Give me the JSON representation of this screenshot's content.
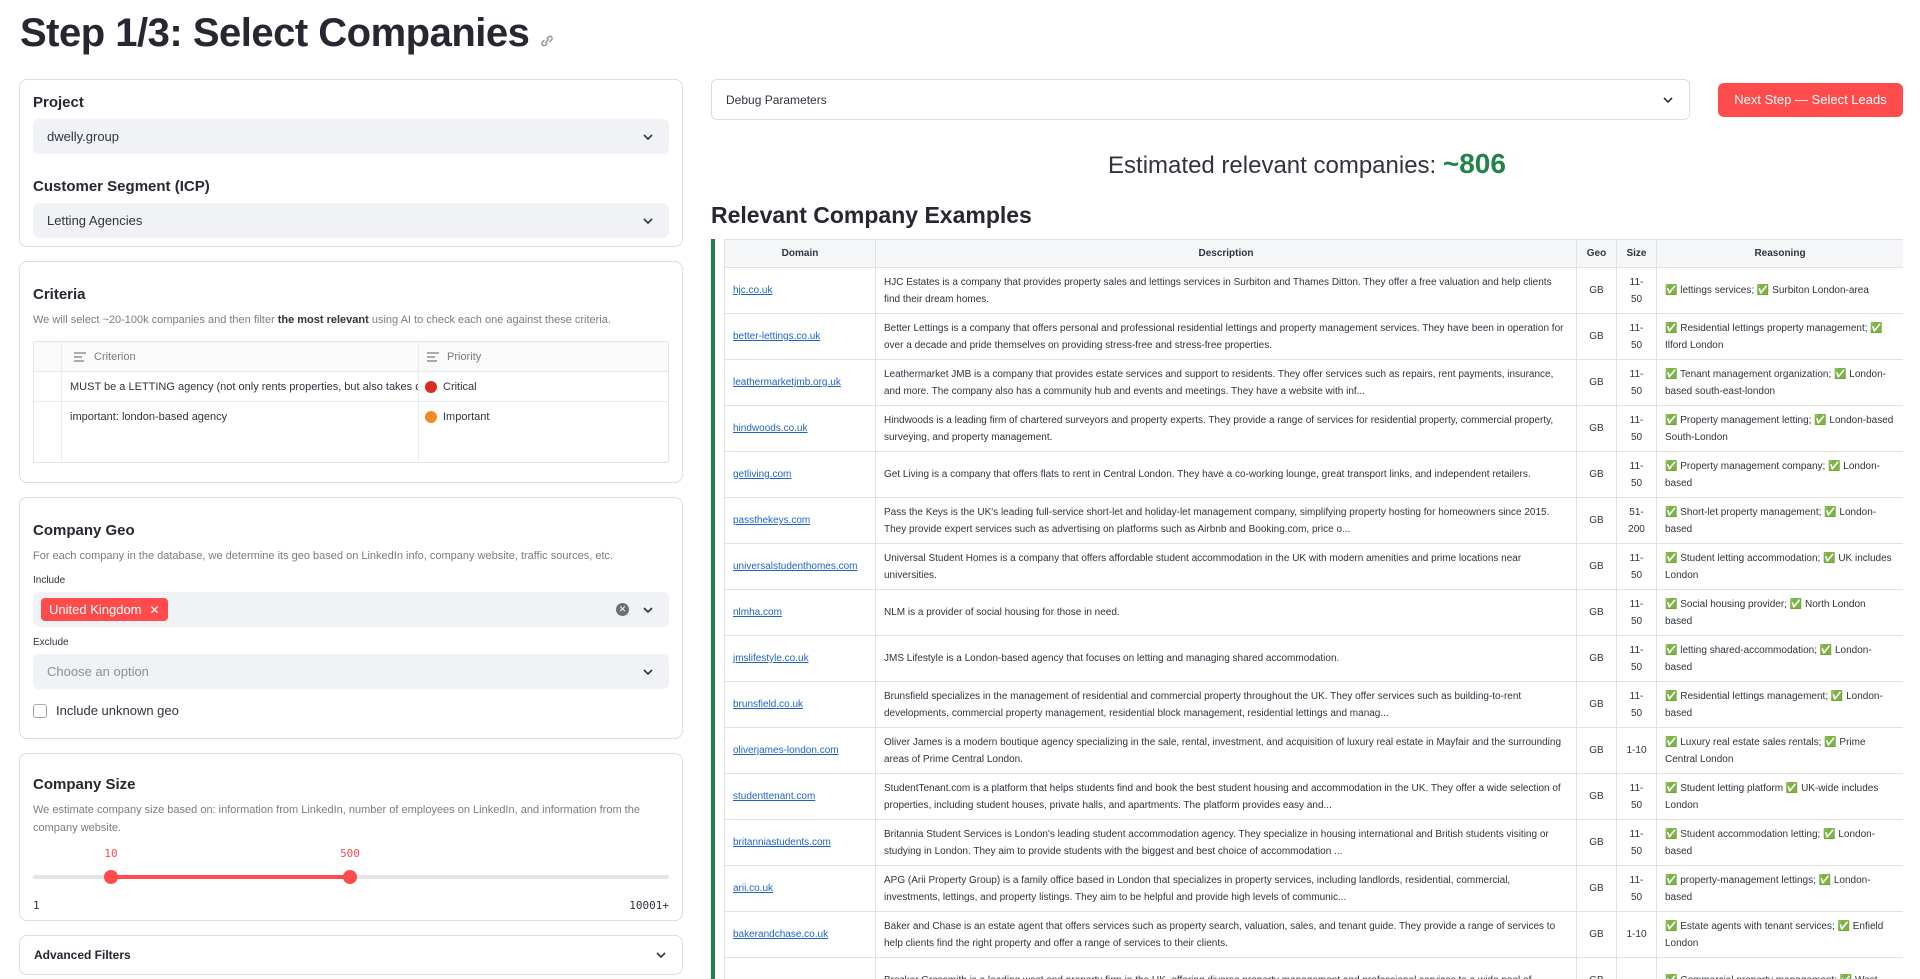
{
  "title": "Step 1/3: Select Companies",
  "project": {
    "label": "Project",
    "value": "dwelly.group"
  },
  "segment": {
    "label": "Customer Segment (ICP)",
    "value": "Letting Agencies"
  },
  "criteria": {
    "title": "Criteria",
    "hint_pre": "We will select ~20-100k companies and then filter ",
    "hint_bold": "the most relevant",
    "hint_post": " using AI to check each one against these criteria.",
    "col1": "Criterion",
    "col2": "Priority",
    "rows": [
      {
        "criterion": "MUST be a LETTING agency (not only rents properties, but also takes or",
        "priority": "Critical",
        "color": "#d62d20"
      },
      {
        "criterion": "important: london-based agency",
        "priority": "Important",
        "color": "#f08a24"
      }
    ]
  },
  "geo": {
    "title": "Company Geo",
    "hint": "For each company in the database, we determine its geo based on LinkedIn info, company website, traffic sources, etc.",
    "include_label": "Include",
    "include_chip": "United Kingdom",
    "exclude_label": "Exclude",
    "exclude_placeholder": "Choose an option",
    "unknown_label": "Include unknown geo"
  },
  "size": {
    "title": "Company Size",
    "hint": "We estimate company size based on: information from LinkedIn, number of employees on LinkedIn, and information from the company website.",
    "low": "10",
    "high": "500",
    "min": "1",
    "max": "10001+"
  },
  "advanced": {
    "label": "Advanced Filters"
  },
  "debug": {
    "label": "Debug Parameters"
  },
  "next_button": "Next Step — Select Leads",
  "estimate": {
    "label": "Estimated relevant companies: ",
    "value": "~806"
  },
  "examples_title": "Relevant Company Examples",
  "table": {
    "headers": [
      "Domain",
      "Description",
      "Geo",
      "Size",
      "Reasoning"
    ],
    "rows": [
      [
        "hjc.co.uk",
        "HJC Estates is a company that provides property sales and lettings services in Surbiton and Thames Ditton. They offer a free valuation and help clients find their dream homes.",
        "GB",
        "11-50",
        "✅ lettings services; ✅ Surbiton London-area"
      ],
      [
        "better-lettings.co.uk",
        "Better Lettings is a company that offers personal and professional residential lettings and property management services. They have been in operation for over a decade and pride themselves on providing stress-free and stress-free properties.",
        "GB",
        "11-50",
        "✅ Residential lettings property management; ✅ Ilford London"
      ],
      [
        "leathermarketjmb.org.uk",
        "Leathermarket JMB is a company that provides estate services and support to residents. They offer services such as repairs, rent payments, insurance, and more. The company also has a community hub and events and meetings. They have a website with inf...",
        "GB",
        "11-50",
        "✅ Tenant management organization; ✅ London-based south-east-london"
      ],
      [
        "hindwoods.co.uk",
        "Hindwoods is a leading firm of chartered surveyors and property experts. They provide a range of services for residential property, commercial property, surveying, and property management.",
        "GB",
        "11-50",
        "✅ Property management letting; ✅ London-based South-London"
      ],
      [
        "getliving.com",
        "Get Living is a company that offers flats to rent in Central London. They have a co-working lounge, great transport links, and independent retailers.",
        "GB",
        "11-50",
        "✅ Property management company; ✅ London-based"
      ],
      [
        "passthekeys.com",
        "Pass the Keys is the UK's leading full-service short-let and holiday-let management company, simplifying property hosting for homeowners since 2015. They provide expert services such as advertising on platforms such as Airbnb and Booking.com, price o...",
        "GB",
        "51-200",
        "✅ Short-let property management; ✅ London-based"
      ],
      [
        "universalstudenthomes.com",
        "Universal Student Homes is a company that offers affordable student accommodation in the UK with modern amenities and prime locations near universities.",
        "GB",
        "11-50",
        "✅ Student letting accommodation; ✅ UK includes London"
      ],
      [
        "nlmha.com",
        "NLM is a provider of social housing for those in need.",
        "GB",
        "11-50",
        "✅ Social housing provider; ✅ North London based"
      ],
      [
        "jmslifestyle.co.uk",
        "JMS Lifestyle is a London-based agency that focuses on letting and managing shared accommodation.",
        "GB",
        "11-50",
        "✅ letting shared-accommodation; ✅ London-based"
      ],
      [
        "brunsfield.co.uk",
        "Brunsfield specializes in the management of residential and commercial property throughout the UK. They offer services such as building-to-rent developments, commercial property management, residential block management, residential lettings and manag...",
        "GB",
        "11-50",
        "✅ Residential lettings management; ✅ London-based"
      ],
      [
        "oliverjames-london.com",
        "Oliver James is a modern boutique agency specializing in the sale, rental, investment, and acquisition of luxury real estate in Mayfair and the surrounding areas of Prime Central London.",
        "GB",
        "1-10",
        "✅ Luxury real estate sales rentals; ✅ Prime Central London"
      ],
      [
        "studenttenant.com",
        "StudentTenant.com is a platform that helps students find and book the best student housing and accommodation in the UK. They offer a wide selection of properties, including student houses, private halls, and apartments. The platform provides easy and...",
        "GB",
        "11-50",
        "✅ Student letting platform ✅ UK-wide includes London"
      ],
      [
        "britanniastudents.com",
        "Britannia Student Services is London's leading student accommodation agency. They specialize in housing international and British students visiting or studying in London. They aim to provide students with the biggest and best choice of accommodation ...",
        "GB",
        "11-50",
        "✅ Student accommodation letting; ✅ London-based"
      ],
      [
        "arii.co.uk",
        "APG (Arii Property Group) is a family office based in London that specializes in property services, including landlords, residential, commercial, investments, lettings, and property listings. They aim to be helpful and provide high levels of communic...",
        "GB",
        "11-50",
        "✅ property-management lettings; ✅ London-based"
      ],
      [
        "bakerandchase.co.uk",
        "Baker and Chase is an estate agent that offers services such as property search, valuation, sales, and tenant guide. They provide a range of services to help clients find the right property and offer a range of services to their clients.",
        "GB",
        "1-10",
        "✅ Estate agents with tenant services; ✅ Enfield London"
      ],
      [
        "",
        "Brocker Grossmith is a leading west end property firm in the UK, offering diverse property management and professional services to a wide pool of",
        "GB",
        "",
        "✅ Commercial property management; ✅ West"
      ]
    ]
  }
}
